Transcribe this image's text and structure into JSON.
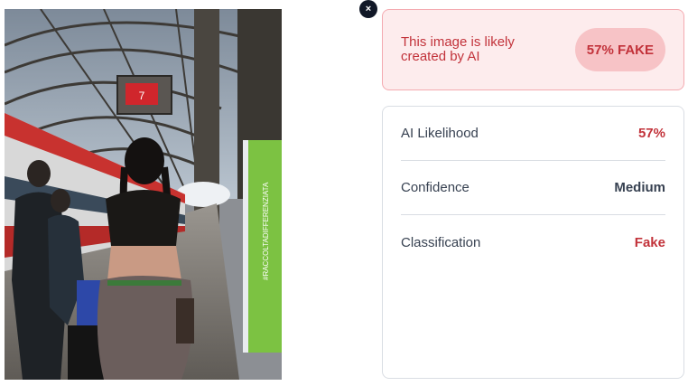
{
  "close_button": {
    "glyph": "×"
  },
  "verdict": {
    "message": "This image is likely created by AI",
    "badge": "57% FAKE",
    "colors": {
      "background": "#fdeced",
      "border": "#f4aab0",
      "text": "#c2323a",
      "badge_background": "#f7c3c6"
    }
  },
  "details": {
    "rows": [
      {
        "label": "AI Likelihood",
        "value": "57%"
      },
      {
        "label": "Confidence",
        "value": "Medium"
      },
      {
        "label": "Classification",
        "value": "Fake"
      }
    ]
  },
  "photo": {
    "display_text": "7",
    "billboard_text": "#RACCOLTADIFFERENZIATA"
  }
}
